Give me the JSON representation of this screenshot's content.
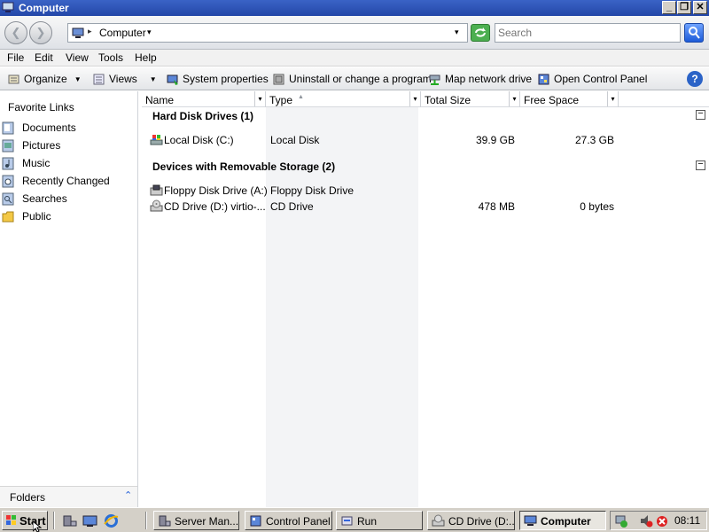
{
  "window": {
    "title": "Computer",
    "minimize_label": "_",
    "maximize_label": "❐",
    "close_label": "✕"
  },
  "address": {
    "back_glyph": "❮",
    "forward_glyph": "❯",
    "separator": "▸",
    "location": "Computer",
    "location_dropdown": "▾",
    "history_dropdown": "▾"
  },
  "search": {
    "placeholder": "Search"
  },
  "menu": {
    "file": "File",
    "edit": "Edit",
    "view": "View",
    "tools": "Tools",
    "help": "Help"
  },
  "toolbar": {
    "organize": "Organize",
    "views": "Views",
    "system_properties": "System properties",
    "uninstall": "Uninstall or change a program",
    "map_drive": "Map network drive",
    "control_panel": "Open Control Panel",
    "dropdown_glyph": "▼",
    "help_glyph": "?"
  },
  "sidebar": {
    "title": "Favorite Links",
    "links": [
      {
        "label": "Documents",
        "icon": "documents-icon"
      },
      {
        "label": "Pictures",
        "icon": "pictures-icon"
      },
      {
        "label": "Music",
        "icon": "music-icon"
      },
      {
        "label": "Recently Changed",
        "icon": "recently-changed-icon"
      },
      {
        "label": "Searches",
        "icon": "searches-icon"
      },
      {
        "label": "Public",
        "icon": "public-folder-icon"
      }
    ],
    "folders_label": "Folders",
    "folders_toggle": "⌃"
  },
  "columns": {
    "name": "Name",
    "type": "Type",
    "total_size": "Total Size",
    "free_space": "Free Space",
    "dropdown_glyph": "▾",
    "sort_glyph": "▲"
  },
  "groups": [
    {
      "title": "Hard Disk Drives (1)",
      "collapse_glyph": "−",
      "items": [
        {
          "name": "Local Disk (C:)",
          "type": "Local Disk",
          "total": "39.9 GB",
          "free": "27.3 GB",
          "icon": "hard-disk-icon"
        }
      ]
    },
    {
      "title": "Devices with Removable Storage (2)",
      "collapse_glyph": "−",
      "items": [
        {
          "name": "Floppy Disk Drive (A:)",
          "type": "Floppy Disk Drive",
          "total": "",
          "free": "",
          "icon": "floppy-drive-icon"
        },
        {
          "name": "CD Drive (D:) virtio-...",
          "type": "CD Drive",
          "total": "478 MB",
          "free": "0 bytes",
          "icon": "cd-drive-icon"
        }
      ]
    }
  ],
  "taskbar": {
    "start": "Start",
    "buttons": [
      {
        "label": "Server Man...",
        "icon": "server-manager-icon"
      },
      {
        "label": "Control Panel",
        "icon": "control-panel-icon"
      },
      {
        "label": "Run",
        "icon": "run-icon"
      },
      {
        "label": "CD Drive (D:...",
        "icon": "cd-drive-icon"
      },
      {
        "label": "Computer",
        "icon": "computer-icon"
      }
    ],
    "clock": "08:11"
  },
  "colors": {
    "title_bar": "#2447a8",
    "type_column_bg": "#f3f4f6",
    "taskbar": "#d4d0c8"
  }
}
